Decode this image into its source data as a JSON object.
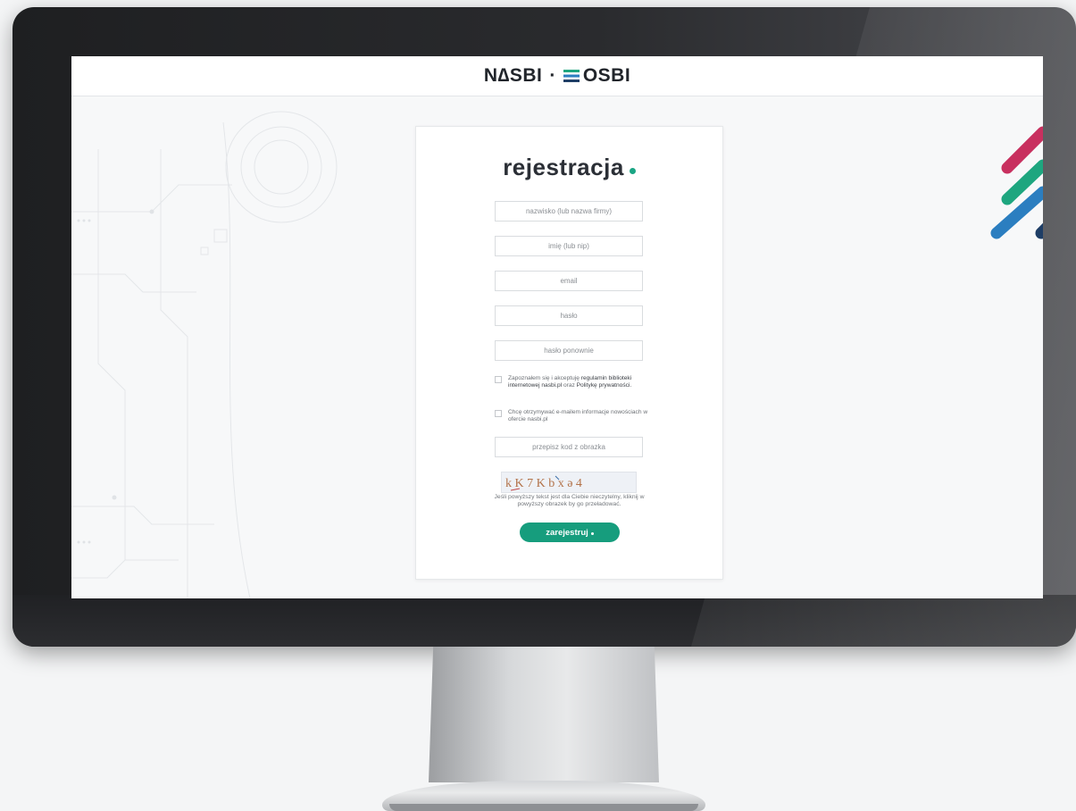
{
  "header": {
    "logo_left": "N∆SBI",
    "logo_sep": "·",
    "logo_right": "OSBI"
  },
  "form": {
    "title": "rejestracja",
    "fields": [
      {
        "placeholder": "nazwisko (lub nazwa firmy)"
      },
      {
        "placeholder": "imię (lub nip)"
      },
      {
        "placeholder": "email"
      },
      {
        "placeholder": "hasło"
      },
      {
        "placeholder": "hasło ponownie"
      }
    ],
    "terms": {
      "prefix": "Zapoznałem się i akceptuję",
      "link1": "regulamin biblioteki internetowej nasbi.pl",
      "mid": "oraz",
      "link2": "Politykę prywatności."
    },
    "newsletter": "Chcę otrzymywać e-mailem informacje nowościach w ofercie nasbi.pl",
    "captcha_field": {
      "placeholder": "przepisz kod z obrazka"
    },
    "captcha_text": "k  K  7  K  b  x  ə  4",
    "captcha_note": "Jeśli powyższy tekst jest dla Ciebie nieczytelny, kliknij w powyższy obrazek by go przeładować.",
    "submit_label": "zarejestruj"
  },
  "colors": {
    "accent": "#169d7d",
    "stripe_1": "#c8305f",
    "stripe_2": "#1ea67f",
    "stripe_3": "#2b7ec0",
    "stripe_4": "#1e3e66"
  }
}
